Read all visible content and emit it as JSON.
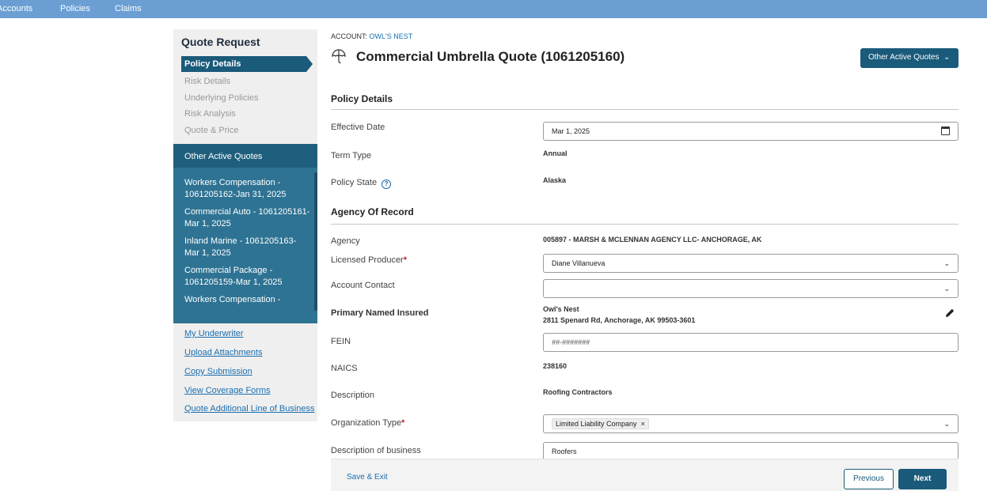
{
  "topnav": {
    "items": [
      "Accounts",
      "Policies",
      "Claims"
    ]
  },
  "sidebar": {
    "title": "Quote Request",
    "steps": [
      "Policy Details",
      "Risk Details",
      "Underlying Policies",
      "Risk Analysis",
      "Quote & Price"
    ],
    "other_quotes_header": "Other Active Quotes",
    "other_quotes": [
      "Workers Compensation - 1061205162-Jan 31, 2025",
      "Commercial Auto - 1061205161-Mar 1, 2025",
      "Inland Marine - 1061205163-Mar 1, 2025",
      "Commercial Package - 1061205159-Mar 1, 2025",
      "Workers Compensation -"
    ],
    "links": [
      "My Underwriter",
      "Upload Attachments",
      "Copy Submission",
      "View Coverage Forms",
      "Quote Additional Line of Business"
    ]
  },
  "header": {
    "account_label": "ACCOUNT:",
    "account_name": "OWL'S NEST",
    "title": "Commercial Umbrella Quote (1061205160)",
    "other_quotes_button": "Other Active Quotes",
    "title_icon": "umbrella-icon"
  },
  "policy_details": {
    "heading": "Policy Details",
    "effective_date_label": "Effective Date",
    "effective_date_value": "Mar 1, 2025",
    "term_type_label": "Term Type",
    "term_type_value": "Annual",
    "policy_state_label": "Policy State",
    "policy_state_value": "Alaska"
  },
  "agency": {
    "heading": "Agency Of Record",
    "agency_label": "Agency",
    "agency_value": "005897 - MARSH & MCLENNAN AGENCY LLC- ANCHORAGE, AK",
    "producer_label": "Licensed Producer",
    "producer_value": "Diane Villanueva",
    "contact_label": "Account Contact",
    "contact_value": "",
    "insured_label": "Primary Named Insured",
    "insured_name": "Owl's Nest",
    "insured_address": "2811 Spenard Rd, Anchorage, AK 99503-3601",
    "fein_label": "FEIN",
    "fein_placeholder": "##-#######",
    "naics_label": "NAICS",
    "naics_value": "238160",
    "description_label": "Description",
    "description_value": "Roofing Contractors",
    "org_type_label": "Organization Type",
    "org_type_value": "Limited Liability Company",
    "desc_business_label": "Description of business",
    "desc_business_value": "Roofers"
  },
  "footer": {
    "save_exit": "Save & Exit",
    "previous": "Previous",
    "next": "Next"
  },
  "colors": {
    "topnav": "#6b9fd4",
    "primary": "#1a5a7a",
    "link": "#1a6fb0",
    "required": "#c0252e"
  }
}
